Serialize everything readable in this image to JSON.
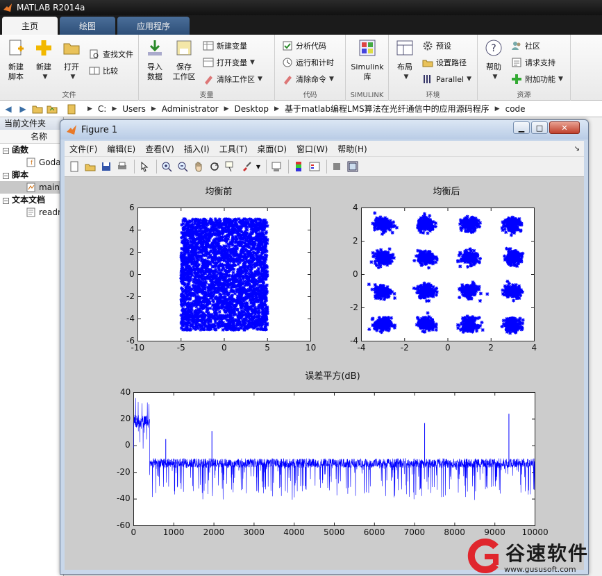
{
  "app": {
    "title": "MATLAB R2014a"
  },
  "ribbon_tabs": [
    "主页",
    "绘图",
    "应用程序"
  ],
  "ribbon": {
    "file": {
      "new_script": "新建\n脚本",
      "new": "新建",
      "open": "打开",
      "find_files": "查找文件",
      "compare": "比较",
      "caption": "文件"
    },
    "variable": {
      "import": "导入\n数据",
      "save_ws": "保存\n工作区",
      "new_var": "新建变量",
      "open_var": "打开变量",
      "clear_ws": "清除工作区",
      "caption": "变量"
    },
    "code": {
      "analyze": "分析代码",
      "run_time": "运行和计时",
      "clear_cmd": "清除命令",
      "caption": "代码"
    },
    "simulink": {
      "lib": "Simulink\n库",
      "caption": "SIMULINK"
    },
    "env": {
      "layout": "布局",
      "prefs": "预设",
      "set_path": "设置路径",
      "parallel": "Parallel",
      "caption": "环境"
    },
    "resources": {
      "help": "帮助",
      "community": "社区",
      "support": "请求支持",
      "addons": "附加功能",
      "caption": "资源"
    }
  },
  "address": {
    "crumbs": [
      "C:",
      "Users",
      "Administrator",
      "Desktop",
      "基于matlab编程LMS算法在光纤通信中的应用源码程序",
      "code"
    ]
  },
  "current_folder": {
    "title": "当前文件夹",
    "col_name": "名称",
    "groups": [
      {
        "label": "函数",
        "items": [
          "Goda"
        ]
      },
      {
        "label": "脚本",
        "items": [
          "main"
        ]
      },
      {
        "label": "文本文档",
        "items": [
          "readn"
        ]
      }
    ]
  },
  "figure": {
    "title": "Figure 1",
    "menus": [
      "文件(F)",
      "编辑(E)",
      "查看(V)",
      "插入(I)",
      "工具(T)",
      "桌面(D)",
      "窗口(W)",
      "帮助(H)"
    ]
  },
  "chart_data": [
    {
      "type": "scatter",
      "title": "均衡前",
      "xlim": [
        -10,
        10
      ],
      "ylim": [
        -6,
        6
      ],
      "xticks": [
        -10,
        -5,
        0,
        5,
        10
      ],
      "yticks": [
        -6,
        -4,
        -2,
        0,
        2,
        4,
        6
      ],
      "marker": "*",
      "color": "#0000ff",
      "cloud": {
        "x_range": [
          -5,
          5
        ],
        "y_range": [
          -5,
          5
        ],
        "distribution": "uniform"
      }
    },
    {
      "type": "scatter",
      "title": "均衡后",
      "xlim": [
        -4,
        4
      ],
      "ylim": [
        -4,
        4
      ],
      "xticks": [
        -4,
        -2,
        0,
        2,
        4
      ],
      "yticks": [
        -4,
        -2,
        0,
        2,
        4
      ],
      "marker": "*",
      "color": "#0000ff",
      "clusters": {
        "x": [
          -3,
          -1,
          1,
          3
        ],
        "y": [
          -3,
          -1,
          1,
          3
        ],
        "spread": 0.35
      }
    },
    {
      "type": "line",
      "title": "误差平方(dB)",
      "xlim": [
        0,
        10000
      ],
      "ylim": [
        -60,
        40
      ],
      "xticks": [
        0,
        1000,
        2000,
        3000,
        4000,
        5000,
        6000,
        7000,
        8000,
        9000,
        10000
      ],
      "yticks": [
        -60,
        -40,
        -20,
        0,
        20,
        40
      ],
      "color": "#0000ff",
      "segments": [
        {
          "x_range": [
            0,
            400
          ],
          "mean_db": 18,
          "variation": 10,
          "peak_db": 37
        },
        {
          "x_range": [
            400,
            10000
          ],
          "mean_db": -13,
          "variation": 7,
          "floor_db": -48
        }
      ],
      "spikes": [
        {
          "x": 800,
          "db": 5
        },
        {
          "x": 1950,
          "db": 11
        },
        {
          "x": 7250,
          "db": 17
        },
        {
          "x": 9350,
          "db": 24
        }
      ]
    }
  ],
  "watermark": {
    "text": "谷速软件",
    "url": "www.gususoft.com",
    "color": "#e0262d"
  }
}
